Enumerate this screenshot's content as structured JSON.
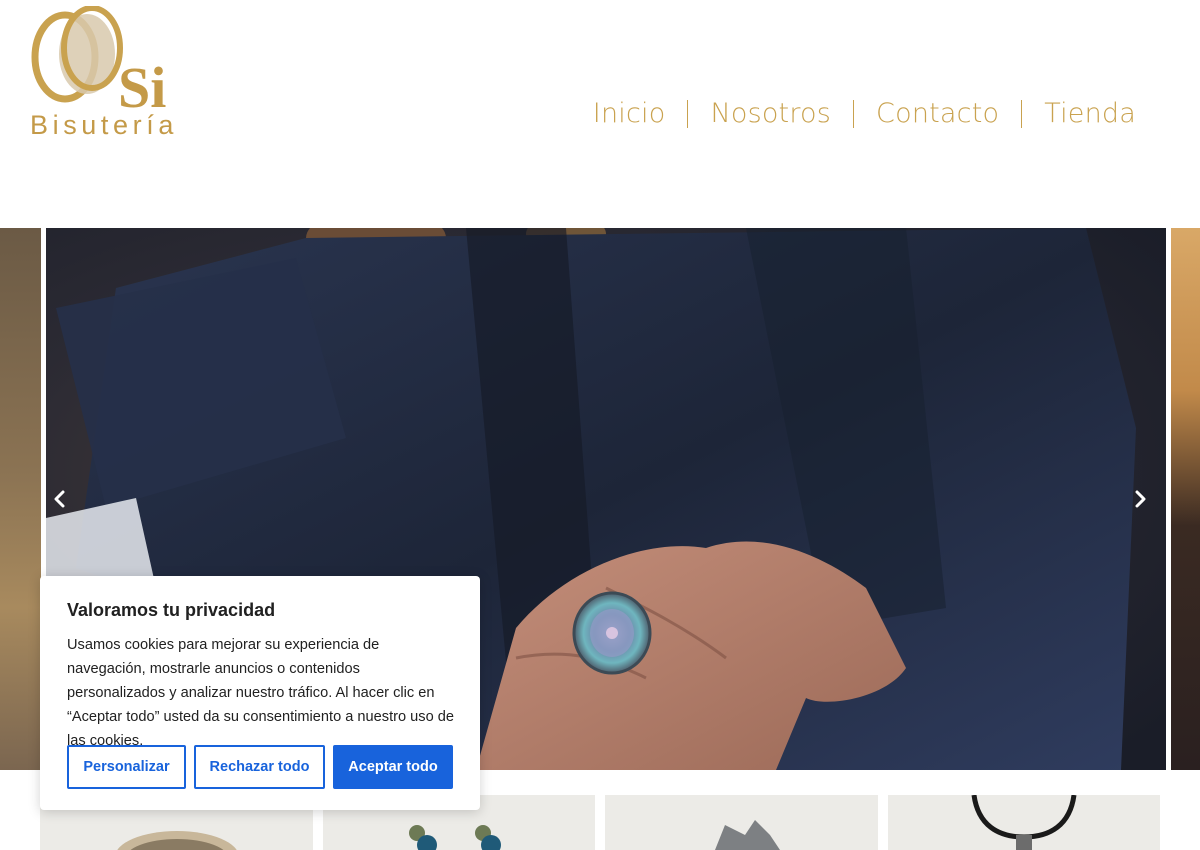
{
  "logo": {
    "mark": "Si",
    "word": "Bisutería"
  },
  "nav": {
    "items": [
      {
        "label": "Inicio"
      },
      {
        "label": "Nosotros"
      },
      {
        "label": "Contacto"
      },
      {
        "label": "Tienda"
      }
    ]
  },
  "slider": {
    "prev_icon": "chevron-left-icon",
    "next_icon": "chevron-right-icon"
  },
  "cookie_banner": {
    "title": "Valoramos tu privacidad",
    "text": "Usamos cookies para mejorar su experiencia de navegación, mostrarle anuncios o contenidos personalizados y analizar nuestro tráfico. Al hacer clic en “Aceptar todo” usted da su consentimiento a nuestro uso de las cookies.",
    "customize_label": "Personalizar",
    "reject_label": "Rechazar todo",
    "accept_label": "Aceptar todo"
  },
  "colors": {
    "brand_gold": "#c9a24f",
    "cookie_accent": "#1863dc"
  }
}
